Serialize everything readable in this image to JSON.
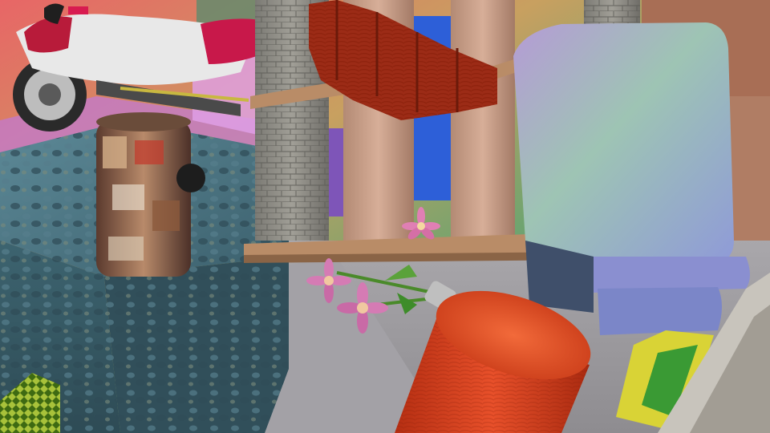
{
  "scene": {
    "kind": "rendered-3d-scene",
    "objects": [
      "motorcycle",
      "stone-block",
      "patterned-cylinder",
      "stone-pillar",
      "wooden-shelf",
      "wooden-post",
      "red-wooden-rack",
      "pastel-cube",
      "flower-vase",
      "orange-cylinder",
      "yellow-green-box",
      "stone-wall",
      "floor"
    ]
  },
  "colors": {
    "sky": "#e36b6a",
    "floor": "#9c9aa0",
    "stone_block": "#3f6a78",
    "stone_pillar": "#8f8d86",
    "wood_shelf": "#b98c67",
    "wood_post": "#c79c85",
    "red_rack": "#9c2b16",
    "pastel_cube": "#9fa7d8",
    "orange_cylinder": "#d9401c",
    "flower_pink": "#d57bb4",
    "yellow_box": "#d9d336",
    "green_box": "#3a9a34"
  }
}
